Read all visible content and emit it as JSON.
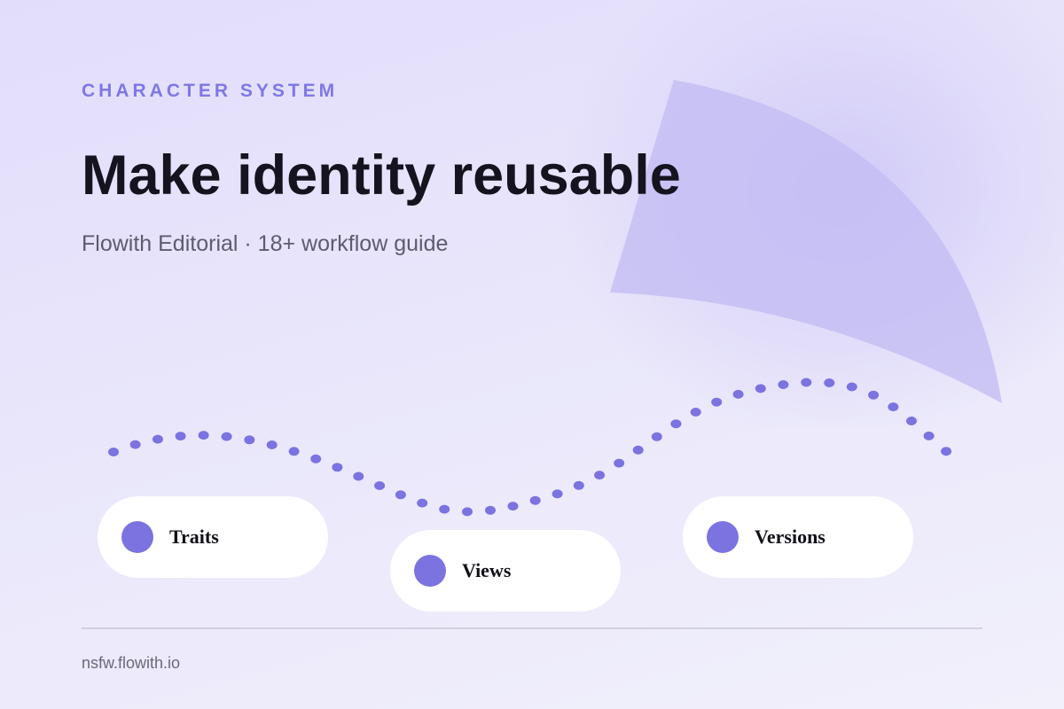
{
  "eyebrow": "CHARACTER SYSTEM",
  "title": "Make identity reusable",
  "subtitle": "Flowith Editorial · 18+ workflow guide",
  "pills": [
    {
      "label": "Traits"
    },
    {
      "label": "Views"
    },
    {
      "label": "Versions"
    }
  ],
  "footer": "nsfw.flowith.io",
  "colors": {
    "accent": "#7f77e6",
    "dot": "#7b73e0",
    "title": "#15131f",
    "subtitle": "#5e5b6e",
    "pill_bg": "#ffffff",
    "shape": "#c3bdf3"
  },
  "icons": {
    "pill_marker": "filled-circle",
    "wave": "dotted-wave",
    "shape": "quarter-circle-arc"
  }
}
